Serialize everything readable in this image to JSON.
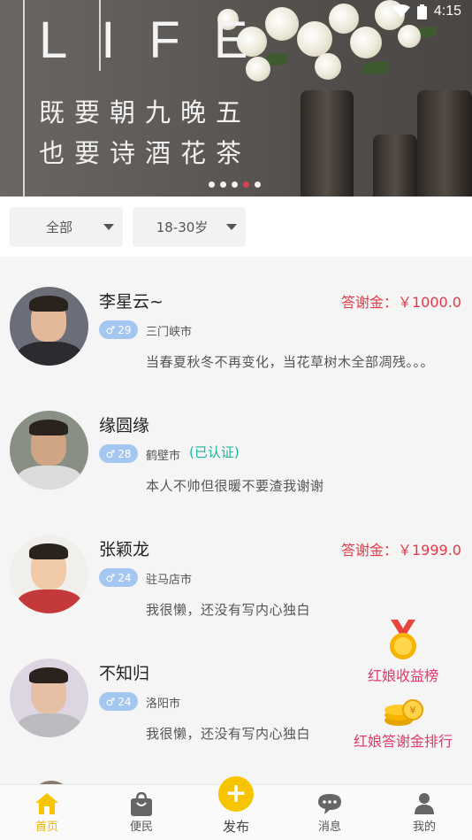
{
  "status_bar": {
    "time": "4:15"
  },
  "banner": {
    "title": "LIFE",
    "line1": "既要朝九晚五",
    "line2": "也要诗酒花茶",
    "dots": 5,
    "active_dot": 3
  },
  "filters": {
    "category": "全部",
    "age": "18-30岁"
  },
  "users": [
    {
      "name": "李星云~",
      "reward": "答谢金：￥1000.0",
      "gender": "♂",
      "age": "29",
      "city": "三门峡市",
      "verified": "",
      "bio": "当春夏秋冬不再变化，当花草树木全部凋残。。。"
    },
    {
      "name": "缘圆缘",
      "reward": "",
      "gender": "♂",
      "age": "28",
      "city": "鹤壁市",
      "verified": "(已认证)",
      "bio": "本人不帅但很暖不要渣我谢谢"
    },
    {
      "name": "张颖龙",
      "reward": "答谢金：￥1999.0",
      "gender": "♂",
      "age": "24",
      "city": "驻马店市",
      "verified": "",
      "bio": "我很懒，还没有写内心独白"
    },
    {
      "name": "不知归",
      "reward": "",
      "gender": "♂",
      "age": "24",
      "city": "洛阳市",
      "verified": "",
      "bio": "我很懒，还没有写内心独白"
    }
  ],
  "widgets": {
    "earnings_rank": "红娘收益榜",
    "reward_rank": "红娘答谢金排行"
  },
  "nav": {
    "home": "首页",
    "convenience": "便民",
    "publish": "发布",
    "messages": "消息",
    "mine": "我的"
  },
  "colors": {
    "accent": "#f7c400",
    "reward": "#e23a48",
    "verified": "#19b59b",
    "badge": "#a4c7f2",
    "widget_text": "#e23a6a"
  }
}
